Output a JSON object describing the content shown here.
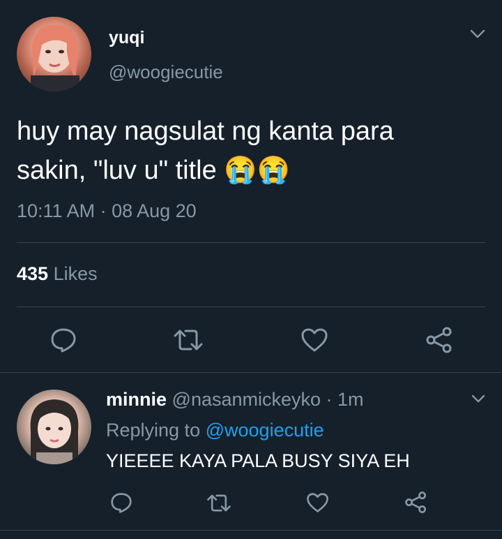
{
  "tweet": {
    "name": "yuqi",
    "handle": "@woogiecutie",
    "text_line1": "huy may nagsulat ng kanta para",
    "text_line2": "sakin, \"luv u\" title",
    "emoji": "😭😭",
    "timestamp": "10:11 AM · 08 Aug 20",
    "likes_count": "435",
    "likes_label": "Likes"
  },
  "reply": {
    "name": "minnie",
    "handle": "@nasanmickeyko",
    "time": "· 1m",
    "replying_prefix": "Replying to",
    "replying_handle": "@woogiecutie",
    "text": "YIEEEE KAYA PALA BUSY SIYA EH"
  },
  "icons": [
    "reply-icon",
    "retweet-icon",
    "like-icon",
    "share-icon",
    "chevron-down-icon"
  ],
  "colors": {
    "background": "#15202b",
    "text": "#ffffff",
    "muted": "#8899a6",
    "link": "#1da1f2",
    "divider": "#38444d"
  }
}
